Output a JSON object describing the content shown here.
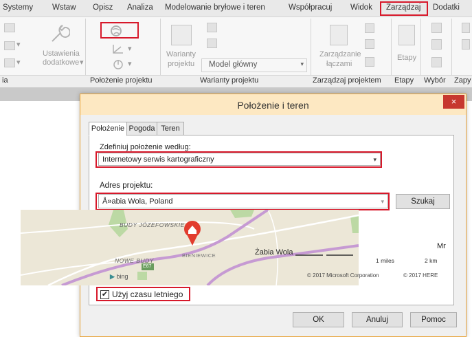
{
  "menu_tabs": [
    "Systemy",
    "Wstaw",
    "Opisz",
    "Analiza",
    "Modelowanie bryłowe i teren",
    "Współpracuj",
    "Widok",
    "Zarządzaj",
    "Dodatki"
  ],
  "ribbon": {
    "settings_label_1": "Ustawienia",
    "settings_label_2": "dodatkowe",
    "variants_label_1": "Warianty",
    "variants_label_2": "projektu",
    "model_combo": "Model główny",
    "manage_links_1": "Zarządzanie",
    "manage_links_2": "łączami",
    "phases_label": "Etapy",
    "panels": [
      "ia",
      "Położenie projektu",
      "Warianty projektu",
      "Zarządzaj projektem",
      "Etapy",
      "Wybór",
      "Zapy"
    ]
  },
  "dialog": {
    "title": "Położenie i teren",
    "close": "×",
    "tabs": [
      "Położenie",
      "Pogoda",
      "Teren"
    ],
    "define_label": "Zdefiniuj położenie według:",
    "define_value": "Internetowy serwis kartograficzny",
    "address_label": "Adres projektu:",
    "address_value": "Å»abia Wola, Poland",
    "search_button": "Szukaj",
    "map": {
      "places": [
        "BUDY JÓZEFOWSKIE",
        "Żabia Wola",
        "NOWE BUDY",
        "BIENIEWICE",
        "E67",
        "Mr"
      ],
      "scale_miles": "1 miles",
      "scale_km": "2 km",
      "copyright_ms": "© 2017 Microsoft Corporation",
      "copyright_here": "© 2017 HERE",
      "brand": "bing"
    },
    "dst_checkbox_label": "Użyj czasu letniego",
    "dst_checked": true,
    "ok_button": "OK",
    "cancel_button": "Anuluj",
    "help_button": "Pomoc"
  },
  "colors": {
    "highlight": "#d7182a",
    "title_bg": "#fde8c2",
    "close_bg": "#c7372f",
    "marker": "#e23c2e"
  }
}
